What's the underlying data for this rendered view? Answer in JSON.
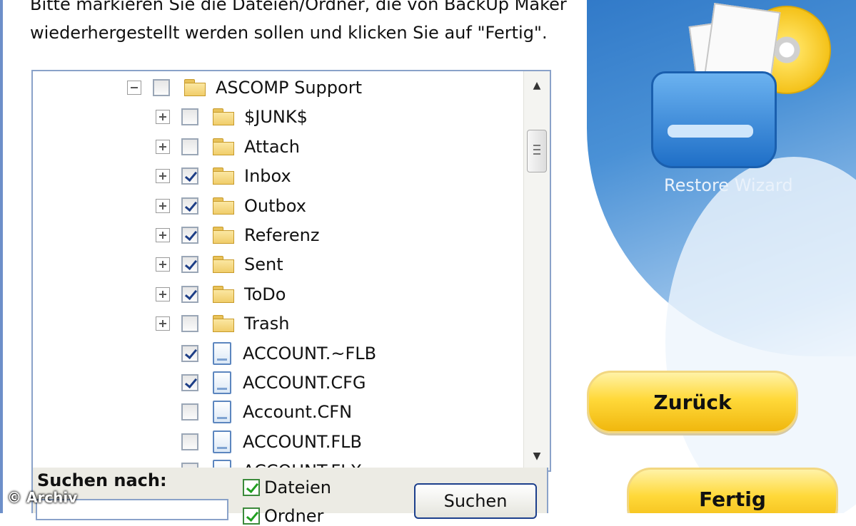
{
  "instruction": "Bitte markieren Sie die Dateien/Ordner, die von BackUp Maker\nwiederhergestellt werden sollen und klicken Sie auf \"Fertig\".",
  "tree": {
    "root": {
      "label": "ASCOMP Support",
      "checked": false,
      "expanded": true
    },
    "items": [
      {
        "label": "$JUNK$",
        "type": "folder",
        "checked": false
      },
      {
        "label": "Attach",
        "type": "folder",
        "checked": false
      },
      {
        "label": "Inbox",
        "type": "folder",
        "checked": true
      },
      {
        "label": "Outbox",
        "type": "folder",
        "checked": true
      },
      {
        "label": "Referenz",
        "type": "folder",
        "checked": true
      },
      {
        "label": "Sent",
        "type": "folder",
        "checked": true
      },
      {
        "label": "ToDo",
        "type": "folder",
        "checked": true
      },
      {
        "label": "Trash",
        "type": "folder",
        "checked": false
      },
      {
        "label": "ACCOUNT.~FLB",
        "type": "file",
        "checked": true
      },
      {
        "label": "ACCOUNT.CFG",
        "type": "file",
        "checked": true
      },
      {
        "label": "Account.CFN",
        "type": "file",
        "checked": false
      },
      {
        "label": "ACCOUNT.FLB",
        "type": "file",
        "checked": false
      },
      {
        "label": "ACCOUNT.FLX",
        "type": "file",
        "checked": false
      }
    ]
  },
  "search": {
    "label": "Suchen nach:",
    "input_value": "",
    "option_files": "Dateien",
    "option_files_checked": true,
    "option_folders": "Ordner",
    "option_folders_checked": true,
    "button": "Suchen"
  },
  "wizard": {
    "title": "Restore Wizard",
    "back": "Zurück",
    "finish": "Fertig"
  },
  "watermark": "© Archiv"
}
